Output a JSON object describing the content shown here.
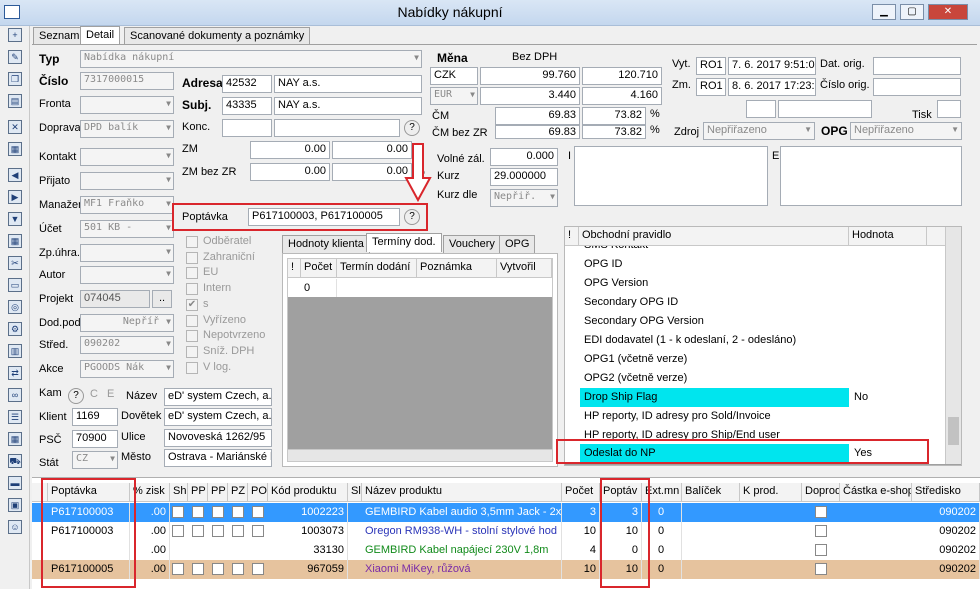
{
  "window": {
    "title": "Nabídky nákupní"
  },
  "tabs": {
    "seznam": "Seznam",
    "detail": "Detail",
    "scan": "Scanované dokumenty a poznámky"
  },
  "left": {
    "typ_label": "Typ",
    "typ": "Nabídka nákupní",
    "cislo_label": "Číslo",
    "cislo": "7317000015",
    "fronta_label": "Fronta",
    "doprava_label": "Doprava",
    "doprava": "DPD balík",
    "kontakt_label": "Kontakt",
    "prijato_label": "Přijato",
    "manazer_label": "Manažer",
    "manazer": "MF1 Fraňko",
    "ucet_label": "Účet",
    "ucet": "501  KB -",
    "zpuhr_label": "Zp.úhra.",
    "autor_label": "Autor",
    "projekt_label": "Projekt",
    "projekt": "074045",
    "projekt_btn": "..",
    "dodpod_label": "Dod.pod",
    "dodpod": "Nepříř",
    "stred_label": "Střed.",
    "stred": "090202",
    "akce_label": "Akce",
    "akce": "PGOODS Nák"
  },
  "adresa": {
    "adresa_label": "Adresa",
    "adresa_code": "42532",
    "adresa_name": "NAY a.s.",
    "subj_label": "Subj.",
    "subj_code": "43335",
    "subj_name": "NAY a.s.",
    "konc_label": "Konc.",
    "zm_label": "ZM",
    "zm": "0.00",
    "zm2": "0.00",
    "zmbez_label": "ZM bez ZR",
    "zmbez": "0.00",
    "zmbez2": "0.00",
    "pct": "%"
  },
  "poptavka": {
    "label": "Poptávka",
    "value": "P617100003, P617100005"
  },
  "checks": {
    "odberatel": "Odběratel",
    "zahranicni": "Zahraniční",
    "eu": "EU",
    "intern": "Intern",
    "s": "s",
    "vyrizeno": "Vyřízeno",
    "nepotvrzeno": "Nepotvrzeno",
    "sniz": "Sníž. DPH",
    "vlog": "V log."
  },
  "subtabs": {
    "hodnoty": "Hodnoty klienta",
    "terminy": "Termíny dod.",
    "vouchery": "Vouchery",
    "opg": "OPG"
  },
  "terminy": {
    "h_excl": "!",
    "h_pocet": "Počet",
    "h_termin": "Termín dodání",
    "h_poznamka": "Poznámka",
    "h_vytvoril": "Vytvořil",
    "row_pocet": "0"
  },
  "mena": {
    "mena_label": "Měna",
    "bezdph_label": "Bez DPH",
    "cur1": "CZK",
    "cur1_a": "99.760",
    "cur1_b": "120.710",
    "cur2": "EUR",
    "cur2_a": "3.440",
    "cur2_b": "4.160",
    "cm_label": "ČM",
    "cm_a": "69.83",
    "cm_b": "73.82",
    "cm_pct": "%",
    "cmbez_label": "ČM bez ZR",
    "cmbez_a": "69.83",
    "cmbez_b": "73.82",
    "cmbez_pct": "%",
    "volne_label": "Volné zál.",
    "volne": "0.000",
    "kurz_label": "Kurz",
    "kurz": "29.000000",
    "kurzdle_label": "Kurz dle",
    "kurzdle": "Nepřiř."
  },
  "vyt": {
    "vyt_label": "Vyt.",
    "vyt_user": "RO1",
    "vyt_date": "7. 6. 2017 9:51:0",
    "zm_label": "Zm.",
    "zm_user": "RO1",
    "zm_date": "8. 6. 2017 17:23:",
    "datorig_label": "Dat. orig.",
    "cisloorig_label": "Číslo orig.",
    "tisk_label": "Tisk",
    "zdroj_label": "Zdroj",
    "zdroj": "Nepřiřazeno",
    "opg_label": "OPG",
    "opg": "Nepřiřazeno",
    "i_label": "I",
    "e_label": "E"
  },
  "rules": {
    "h_excl": "!",
    "h_pravidlo": "Obchodní pravidlo",
    "h_hodnota": "Hodnota",
    "rows": [
      {
        "name": "SMS Kontakt",
        "value": ""
      },
      {
        "name": "OPG ID",
        "value": ""
      },
      {
        "name": "OPG Version",
        "value": ""
      },
      {
        "name": "Secondary OPG ID",
        "value": ""
      },
      {
        "name": "Secondary OPG Version",
        "value": ""
      },
      {
        "name": "EDI dodavatel (1 - k odeslaní, 2 - odesláno)",
        "value": ""
      },
      {
        "name": "OPG1 (včetně verze)",
        "value": ""
      },
      {
        "name": "OPG2 (včetně verze)",
        "value": ""
      },
      {
        "name": "Drop Ship Flag",
        "value": "No"
      },
      {
        "name": "HP reporty, ID adresy pro Sold/Invoice",
        "value": ""
      },
      {
        "name": "HP reporty, ID adresy pro Ship/End user",
        "value": ""
      },
      {
        "name": "Odeslat do NP",
        "value": "Yes"
      }
    ]
  },
  "klient": {
    "kam_label": "Kam",
    "c_btn": "C",
    "e_btn": "E",
    "klient_label": "Klient",
    "klient": "1169",
    "psc_label": "PSČ",
    "psc": "70900",
    "stat_label": "Stát",
    "stat": "CZ",
    "nazev_label": "Název",
    "nazev": "eD' system Czech, a.s",
    "dovetek_label": "Dovětek",
    "dovetek": "eD' system Czech, a.s",
    "ulice_label": "Ulice",
    "ulice": "Novoveská 1262/95",
    "mesto_label": "Město",
    "mesto": "Ostrava - Mariánské h"
  },
  "grid": {
    "headers": [
      "Poptávka",
      "% zisk",
      "Sh",
      "PP",
      "PP",
      "PZ",
      "PO",
      "Kód produktu",
      "Sl",
      "Název produktu",
      "Počet",
      "Poptáv",
      "Ext.mn",
      "Balíček",
      "K prod.",
      "Doprod",
      "Částka e-shop",
      "Středisko"
    ],
    "rows": [
      {
        "poptavka": "P617100003",
        "zisk": ".00",
        "kod": "1002223",
        "nazev": "GEMBIRD Kabel audio 3,5mm Jack - 2x",
        "pocet": "3",
        "poptav": "3",
        "ext": "0",
        "stredisko": "090202"
      },
      {
        "poptavka": "P617100003",
        "zisk": ".00",
        "kod": "1003073",
        "nazev": "Oregon RM938-WH - stolní stylové hod",
        "pocet": "10",
        "poptav": "10",
        "ext": "0",
        "stredisko": "090202"
      },
      {
        "poptavka": "",
        "zisk": ".00",
        "kod": "33130",
        "nazev": "GEMBIRD Kabel napájecí 230V 1,8m",
        "pocet": "4",
        "poptav": "0",
        "ext": "0",
        "stredisko": "090202"
      },
      {
        "poptavka": "P617100005",
        "zisk": ".00",
        "kod": "967059",
        "nazev": "Xiaomi MiKey, růžová",
        "pocet": "10",
        "poptav": "10",
        "ext": "0",
        "stredisko": "090202"
      }
    ]
  },
  "colors": {
    "selected": "#3399ff",
    "highlight": "#e6c39e",
    "cyan": "#00e5ee",
    "red": "#d9262c"
  }
}
